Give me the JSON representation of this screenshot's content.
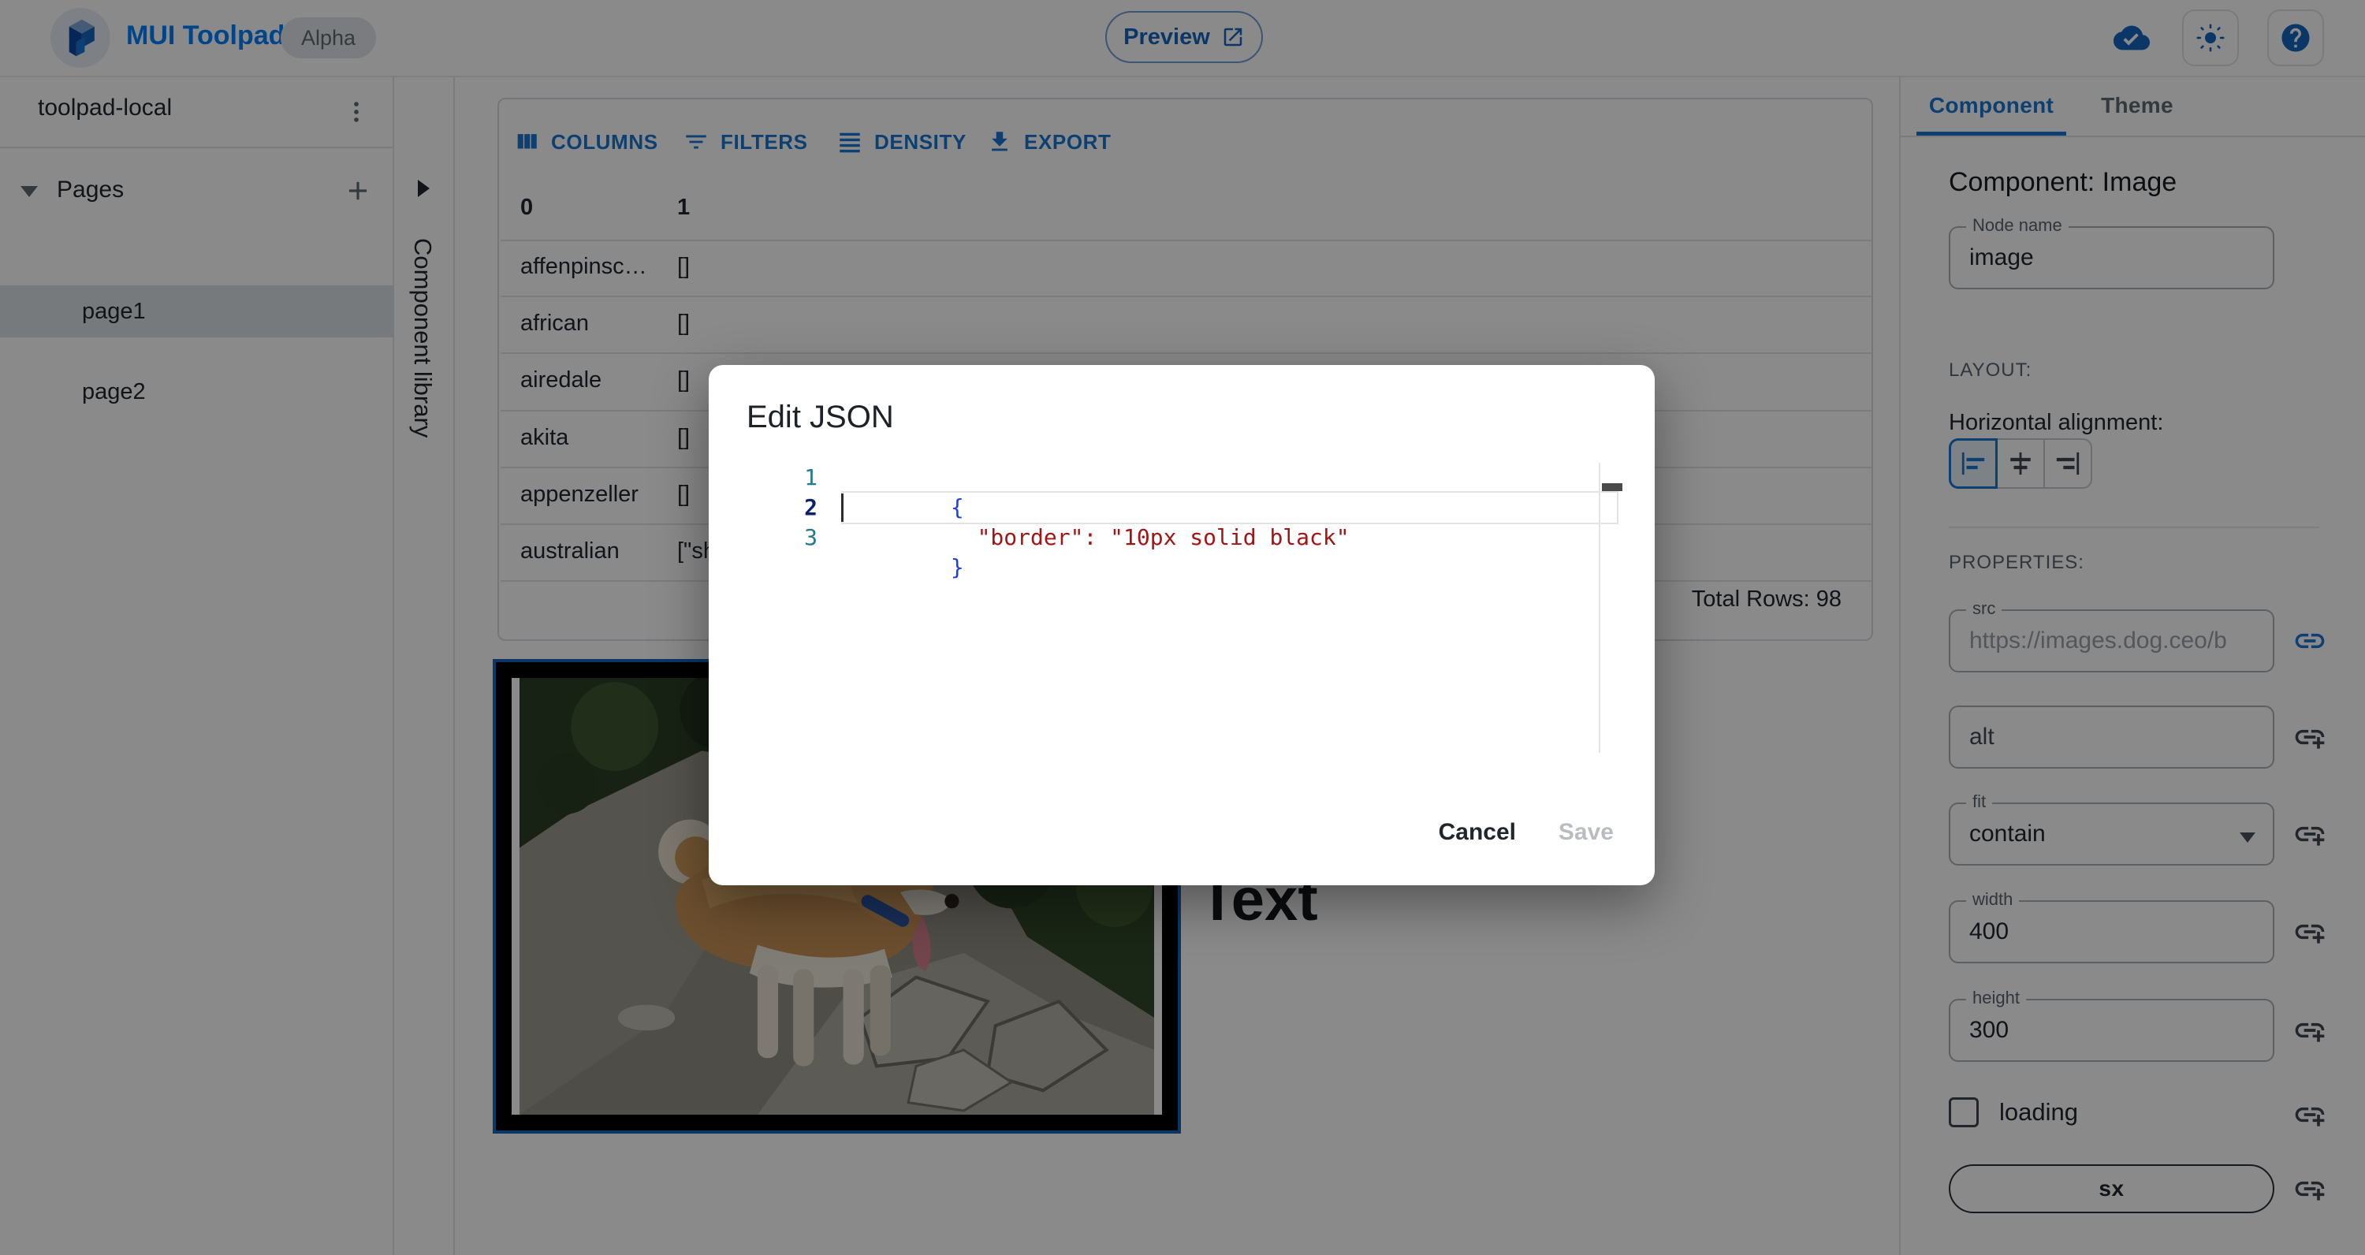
{
  "header": {
    "brand": "MUI Toolpad",
    "badge": "Alpha",
    "preview_label": "Preview"
  },
  "sidebar": {
    "project_name": "toolpad-local",
    "pages_label": "Pages",
    "pages": [
      {
        "label": "page1"
      },
      {
        "label": "page2"
      }
    ]
  },
  "library": {
    "label": "Component library"
  },
  "grid": {
    "toolbar": {
      "columns": "COLUMNS",
      "filters": "FILTERS",
      "density": "DENSITY",
      "export": "EXPORT"
    },
    "headers": {
      "c0": "0",
      "c1": "1"
    },
    "rows": [
      {
        "c0": "affenpinsc…",
        "c1": "[]"
      },
      {
        "c0": "african",
        "c1": "[]"
      },
      {
        "c0": "airedale",
        "c1": "[]"
      },
      {
        "c0": "akita",
        "c1": "[]"
      },
      {
        "c0": "appenzeller",
        "c1": "[]"
      },
      {
        "c0": "australian",
        "c1": "[\"sh"
      }
    ],
    "footer": "Total Rows: 98"
  },
  "canvas": {
    "text_component": "Text"
  },
  "modal": {
    "title": "Edit JSON",
    "cancel_label": "Cancel",
    "save_label": "Save",
    "editor": {
      "ln1": "1",
      "ln2": "2",
      "ln3": "3",
      "line1": "{",
      "indent": "  ",
      "key": "\"border\"",
      "colon": ": ",
      "value": "\"10px solid black\"",
      "line3": "}"
    }
  },
  "panel": {
    "tab_component": "Component",
    "tab_theme": "Theme",
    "heading": "Component: Image",
    "node_name": {
      "label": "Node name",
      "value": "image"
    },
    "layout_label": "LAYOUT:",
    "halign_label": "Horizontal alignment:",
    "properties_label": "PROPERTIES:",
    "src": {
      "label": "src",
      "value": "https://images.dog.ceo/b"
    },
    "alt": {
      "label": "alt"
    },
    "fit": {
      "label": "fit",
      "value": "contain"
    },
    "width": {
      "label": "width",
      "value": "400"
    },
    "height": {
      "label": "height",
      "value": "300"
    },
    "loading_label": "loading",
    "sx_label": "sx"
  },
  "colors": {
    "primary": "#1976d2",
    "brand_blue": "#007fff",
    "selection_blue": "#1565c0",
    "code_string": "#a31515",
    "code_brace": "#1a3ee8",
    "line_number": "#237893",
    "line_number_active": "#0b216f"
  }
}
